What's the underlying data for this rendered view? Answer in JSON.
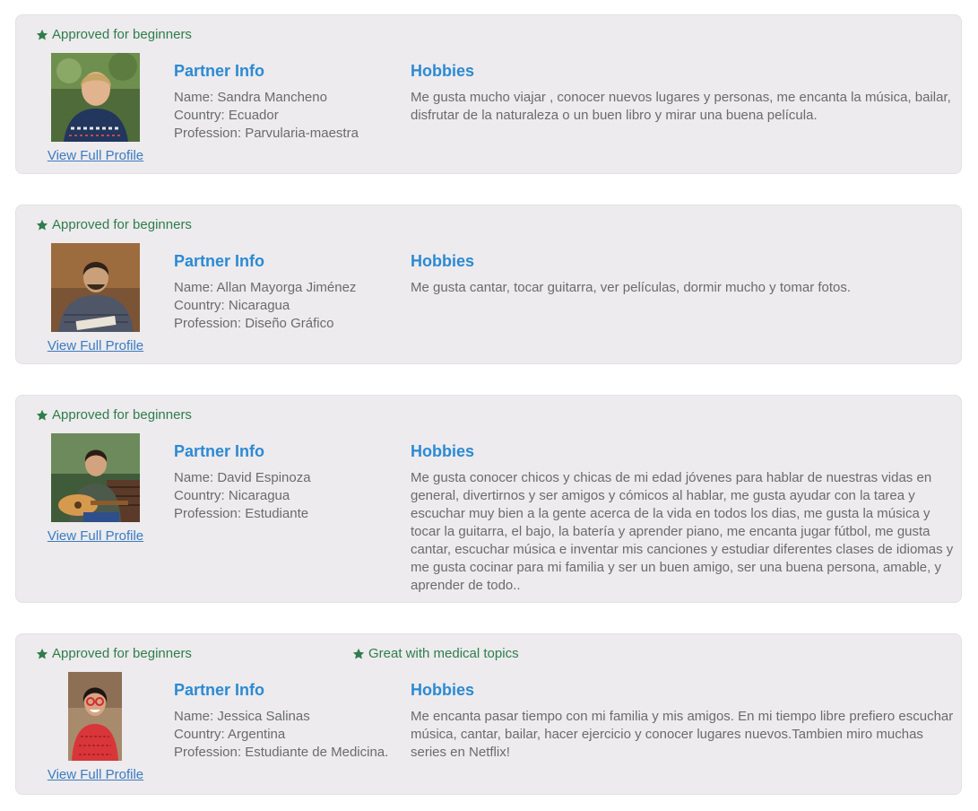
{
  "partners": [
    {
      "badges": [
        "Approved for beginners"
      ],
      "partner_info_title": "Partner Info",
      "name": "Name: Sandra Mancheno",
      "country": "Country: Ecuador",
      "profession": "Profession: Parvularia-maestra",
      "hobbies_title": "Hobbies",
      "hobbies": "Me gusta mucho viajar , conocer nuevos lugares y personas, me encanta la música, bailar, disfrutar de la naturaleza o un buen libro y mirar una buena película.",
      "link": "View Full Profile"
    },
    {
      "badges": [
        "Approved for beginners"
      ],
      "partner_info_title": "Partner Info",
      "name": "Name: Allan Mayorga Jiménez",
      "country": "Country: Nicaragua",
      "profession": "Profession: Diseño Gráfico",
      "hobbies_title": "Hobbies",
      "hobbies": "Me gusta cantar, tocar guitarra, ver películas, dormir mucho y tomar fotos.",
      "link": "View Full Profile"
    },
    {
      "badges": [
        "Approved for beginners"
      ],
      "partner_info_title": "Partner Info",
      "name": "Name: David Espinoza",
      "country": "Country: Nicaragua",
      "profession": "Profession: Estudiante",
      "hobbies_title": "Hobbies",
      "hobbies": "Me gusta conocer chicos y chicas de mi edad jóvenes para hablar de nuestras vidas en general, divertirnos y ser amigos y cómicos al hablar, me gusta ayudar con la tarea y escuchar muy bien a la gente acerca de la vida en todos los dias, me gusta la música y tocar la guitarra, el bajo, la batería y aprender piano, me encanta jugar fútbol, me gusta cantar, escuchar música e inventar mis canciones y estudiar diferentes clases de idiomas y me gusta cocinar para mi familia y ser un buen amigo, ser una buena persona, amable, y aprender de todo..",
      "link": "View Full Profile"
    },
    {
      "badges": [
        "Approved for beginners",
        "Great with medical topics"
      ],
      "partner_info_title": "Partner Info",
      "name": "Name: Jessica Salinas",
      "country": "Country: Argentina",
      "profession": "Profession: Estudiante de Medicina.",
      "hobbies_title": "Hobbies",
      "hobbies": "Me encanta pasar tiempo con mi familia y mis amigos. En mi tiempo libre prefiero escuchar música, cantar, bailar, hacer ejercicio y conocer lugares nuevos.Tambien miro muchas series en Netflix!",
      "link": "View Full Profile"
    }
  ],
  "colors": {
    "card_bg": "#edebee",
    "badge_green": "#2e7d4a",
    "title_blue": "#2b8ad3",
    "link_blue": "#3a7cc0",
    "body_text": "#6b6b6b"
  },
  "icons": {
    "badge": "star-icon"
  }
}
